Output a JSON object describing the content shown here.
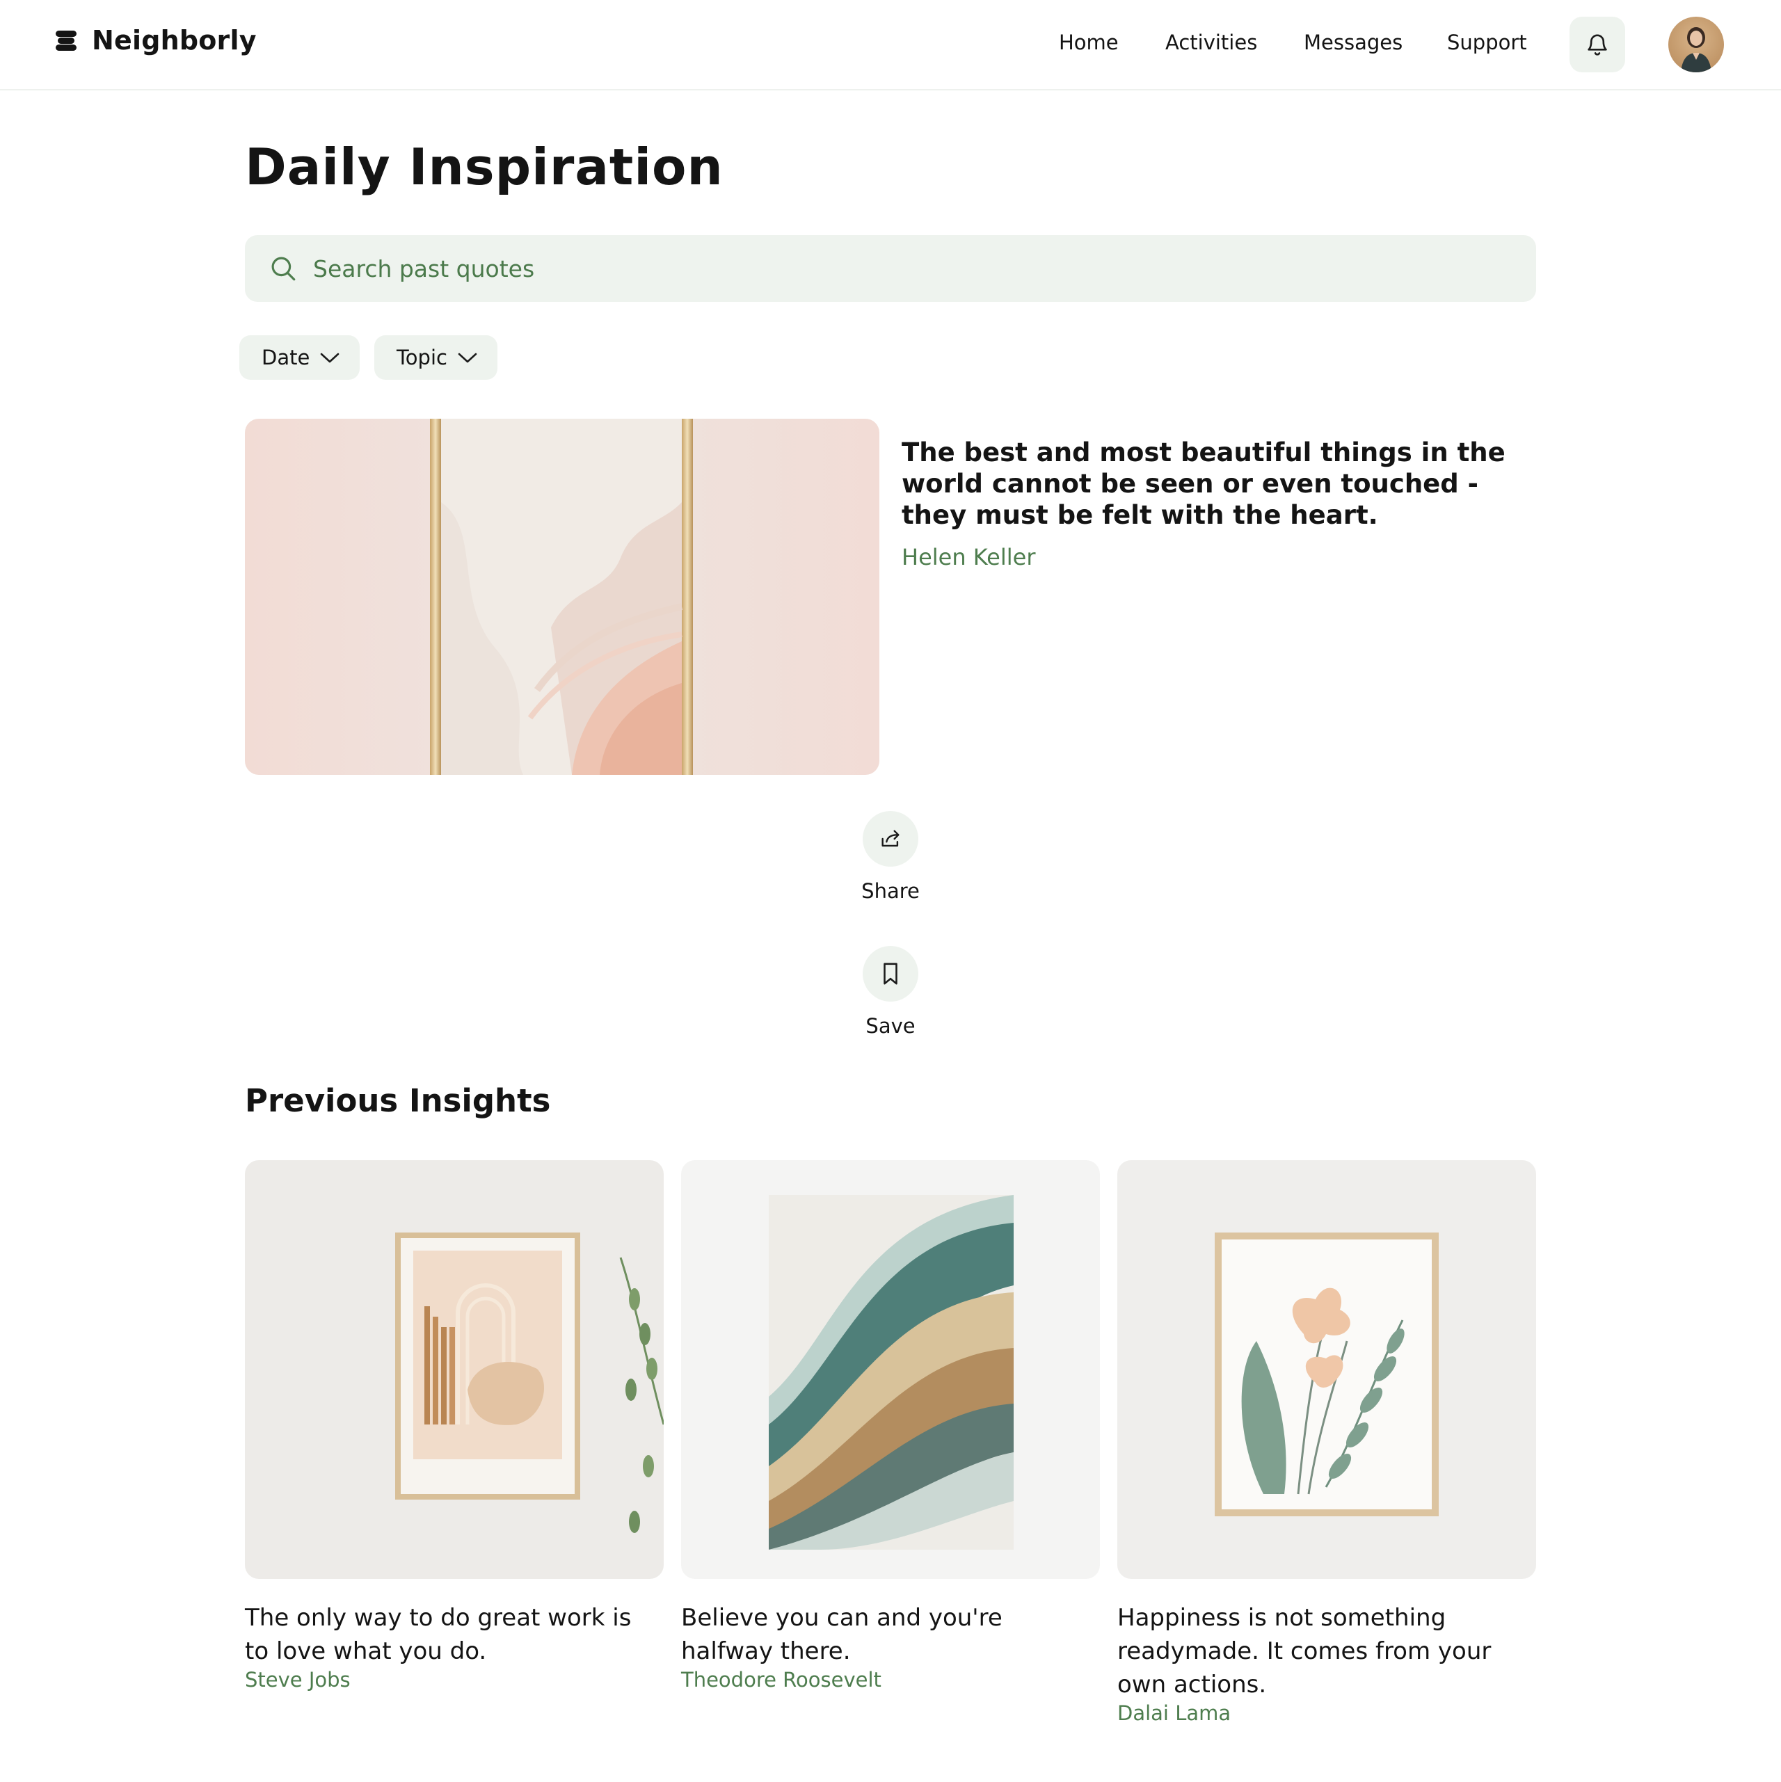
{
  "header": {
    "brand": "Neighborly",
    "nav": [
      "Home",
      "Activities",
      "Messages",
      "Support"
    ]
  },
  "main": {
    "title": "Daily Inspiration",
    "search": {
      "placeholder": "Search past quotes",
      "value": ""
    },
    "filters": [
      "Date",
      "Topic"
    ],
    "featured": {
      "quote": "The best and most beautiful things in the world cannot be seen or even touched - they must be felt with the heart.",
      "author": "Helen Keller"
    },
    "actions": {
      "share": "Share",
      "save": "Save"
    },
    "previous_title": "Previous Insights",
    "previous": [
      {
        "quote": "The only way to do great work is to love what you do.",
        "author": "Steve Jobs"
      },
      {
        "quote": "Believe you can and you're halfway there.",
        "author": "Theodore Roosevelt"
      },
      {
        "quote": "Happiness is not something readymade. It comes from your own actions.",
        "author": "Dalai Lama"
      }
    ]
  },
  "colors": {
    "accent_green": "#4e7d4e",
    "soft_green_bg": "#eef3ee",
    "text": "#141414"
  },
  "icons": [
    "logo-icon",
    "bell-icon",
    "search-icon",
    "chevron-down-icon",
    "share-icon",
    "bookmark-icon"
  ]
}
